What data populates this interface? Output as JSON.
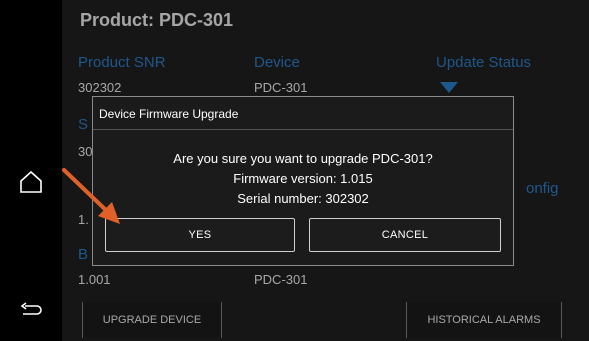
{
  "sidebar": {
    "icons": [
      "home-icon",
      "back-icon"
    ]
  },
  "product": {
    "title": "Product: PDC-301",
    "row1": [
      {
        "header": "Product SNR",
        "value": "302302"
      },
      {
        "header": "Device",
        "value": "PDC-301"
      },
      {
        "header": "Update Status",
        "value": ""
      }
    ],
    "row2": {
      "header_partial": "S",
      "value_partial": "30"
    },
    "row3": {
      "header_partial": "onfig",
      "value_partial": "1."
    },
    "row4": {
      "header_partial": "B",
      "value_left": "1.001",
      "value_right": "PDC-301"
    }
  },
  "toolbar": {
    "upgrade_label": "UPGRADE DEVICE",
    "alarms_label": "HISTORICAL ALARMS"
  },
  "dialog": {
    "title": "Device Firmware Upgrade",
    "question": "Are you sure you want to upgrade PDC-301?",
    "firmware": "Firmware version: 1.015",
    "serial": "Serial number: 302302",
    "yes_label": "YES",
    "cancel_label": "CANCEL"
  },
  "colors": {
    "accent": "#2f86d6",
    "arrow": "#e0602a",
    "background": "#222222"
  }
}
